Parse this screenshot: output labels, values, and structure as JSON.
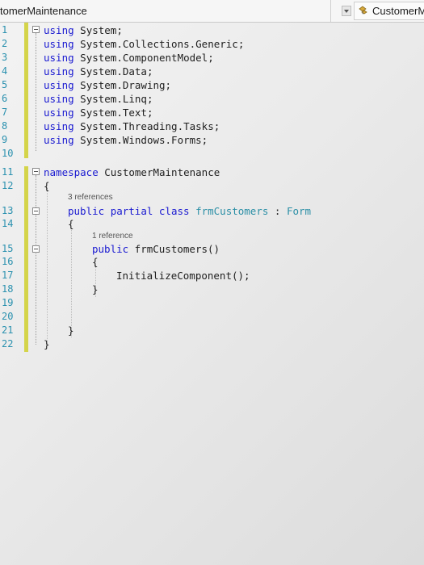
{
  "navbar": {
    "left_text": "tomerMaintenance",
    "right_text": "CustomerM"
  },
  "line_numbers": [
    "1",
    "2",
    "3",
    "4",
    "5",
    "6",
    "7",
    "8",
    "9",
    "10",
    "11",
    "12",
    "13",
    "14",
    "15",
    "16",
    "17",
    "18",
    "19",
    "20",
    "21",
    "22"
  ],
  "code": {
    "lines": [
      {
        "kw": "using",
        "rest": " System;"
      },
      {
        "kw": "using",
        "rest": " System.Collections.Generic;"
      },
      {
        "kw": "using",
        "rest": " System.ComponentModel;"
      },
      {
        "kw": "using",
        "rest": " System.Data;"
      },
      {
        "kw": "using",
        "rest": " System.Drawing;"
      },
      {
        "kw": "using",
        "rest": " System.Linq;"
      },
      {
        "kw": "using",
        "rest": " System.Text;"
      },
      {
        "kw": "using",
        "rest": " System.Threading.Tasks;"
      },
      {
        "kw": "using",
        "rest": " System.Windows.Forms;"
      }
    ],
    "namespace_kw": "namespace",
    "namespace_name": " CustomerMaintenance",
    "open_brace_ns": "{",
    "class_refs": "3 references",
    "class_kw1": "public",
    "class_kw2": "partial",
    "class_kw3": "class",
    "class_name": " frmCustomers",
    "class_colon": " : ",
    "class_base": "Form",
    "open_brace_class": "{",
    "ctor_refs": "1 reference",
    "ctor_kw": "public",
    "ctor_name": " frmCustomers()",
    "open_brace_ctor": "{",
    "init_call": "InitializeComponent();",
    "close_brace_ctor": "}",
    "close_brace_class": "}",
    "close_brace_ns": "}"
  }
}
